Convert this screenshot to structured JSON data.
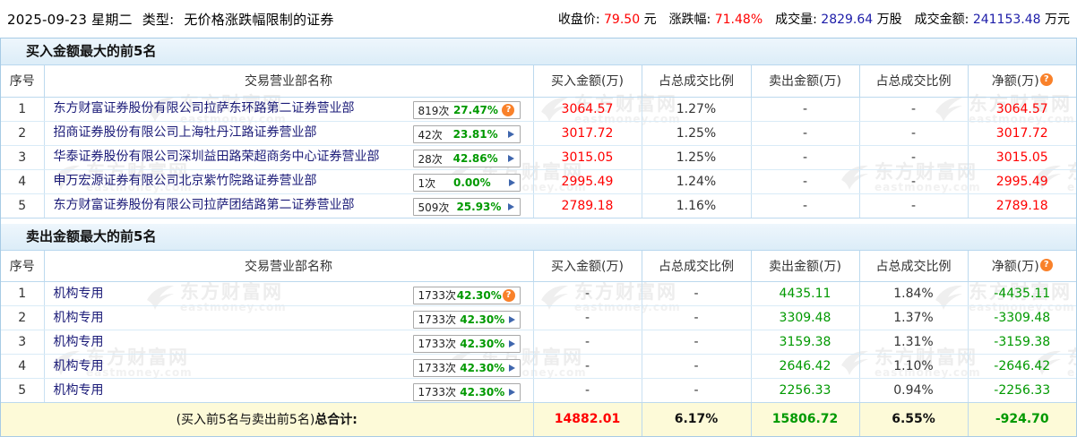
{
  "top": {
    "date_text": "2025-09-23 星期二",
    "type_label": "类型:",
    "type_value": "无价格涨跌幅限制的证券",
    "stats": {
      "close_label": "收盘价:",
      "close_value": "79.50",
      "close_unit": "元",
      "change_label": "涨跌幅:",
      "change_value": "71.48%",
      "volume_label": "成交量:",
      "volume_value": "2829.64",
      "volume_unit": "万股",
      "amount_label": "成交金额:",
      "amount_value": "241153.48",
      "amount_unit": "万元"
    }
  },
  "columns": [
    "序号",
    "交易营业部名称",
    "买入金额(万)",
    "占总成交比例",
    "卖出金额(万)",
    "占总成交比例",
    "净额(万)"
  ],
  "icons": {
    "question": "?"
  },
  "buy_table": {
    "title": "买入金额最大的前5名",
    "rows": [
      {
        "no": "1",
        "name": "东方财富证券股份有限公司拉萨东环路第二证券营业部",
        "count": "819次",
        "pct": "27.47%",
        "icon": "question-icon",
        "buy": "3064.57",
        "buy_ratio": "1.27%",
        "sell": "-",
        "sell_ratio": "-",
        "net": "3064.57"
      },
      {
        "no": "2",
        "name": "招商证券股份有限公司上海牡丹江路证券营业部",
        "count": "42次",
        "pct": "23.81%",
        "icon": "arrow-icon",
        "buy": "3017.72",
        "buy_ratio": "1.25%",
        "sell": "-",
        "sell_ratio": "-",
        "net": "3017.72"
      },
      {
        "no": "3",
        "name": "华泰证券股份有限公司深圳益田路荣超商务中心证券营业部",
        "count": "28次",
        "pct": "42.86%",
        "icon": "arrow-icon",
        "buy": "3015.05",
        "buy_ratio": "1.25%",
        "sell": "-",
        "sell_ratio": "-",
        "net": "3015.05"
      },
      {
        "no": "4",
        "name": "申万宏源证券有限公司北京紫竹院路证券营业部",
        "count": "1次",
        "pct": "0.00%",
        "icon": "arrow-icon",
        "buy": "2995.49",
        "buy_ratio": "1.24%",
        "sell": "-",
        "sell_ratio": "-",
        "net": "2995.49"
      },
      {
        "no": "5",
        "name": "东方财富证券股份有限公司拉萨团结路第二证券营业部",
        "count": "509次",
        "pct": "25.93%",
        "icon": "arrow-icon",
        "buy": "2789.18",
        "buy_ratio": "1.16%",
        "sell": "-",
        "sell_ratio": "-",
        "net": "2789.18"
      }
    ]
  },
  "sell_table": {
    "title": "卖出金额最大的前5名",
    "rows": [
      {
        "no": "1",
        "name": "机构专用",
        "count": "1733次",
        "pct": "42.30%",
        "icon": "question-icon",
        "buy": "-",
        "buy_ratio": "-",
        "sell": "4435.11",
        "sell_ratio": "1.84%",
        "net": "-4435.11"
      },
      {
        "no": "2",
        "name": "机构专用",
        "count": "1733次",
        "pct": "42.30%",
        "icon": "arrow-icon",
        "buy": "-",
        "buy_ratio": "-",
        "sell": "3309.48",
        "sell_ratio": "1.37%",
        "net": "-3309.48"
      },
      {
        "no": "3",
        "name": "机构专用",
        "count": "1733次",
        "pct": "42.30%",
        "icon": "arrow-icon",
        "buy": "-",
        "buy_ratio": "-",
        "sell": "3159.38",
        "sell_ratio": "1.31%",
        "net": "-3159.38"
      },
      {
        "no": "4",
        "name": "机构专用",
        "count": "1733次",
        "pct": "42.30%",
        "icon": "arrow-icon",
        "buy": "-",
        "buy_ratio": "-",
        "sell": "2646.42",
        "sell_ratio": "1.10%",
        "net": "-2646.42"
      },
      {
        "no": "5",
        "name": "机构专用",
        "count": "1733次",
        "pct": "42.30%",
        "icon": "arrow-icon",
        "buy": "-",
        "buy_ratio": "-",
        "sell": "2256.33",
        "sell_ratio": "0.94%",
        "net": "-2256.33"
      }
    ]
  },
  "footer": {
    "label_prefix": "(买入前5名与卖出前5名)",
    "label_bold": "总合计:",
    "buy_total": "14882.01",
    "buy_ratio_total": "6.17%",
    "sell_total": "15806.72",
    "sell_ratio_total": "6.55%",
    "net_total": "-924.70"
  },
  "watermark": {
    "brand": "东方财富网",
    "domain": "eastmoney.com"
  },
  "colors": {
    "red": "#ff0000",
    "green": "#009900",
    "blue_number": "#1c1ca8",
    "link_navy": "#1b1b78",
    "panel_border": "#a7cbe5",
    "footer_bg": "#fdfad8"
  }
}
